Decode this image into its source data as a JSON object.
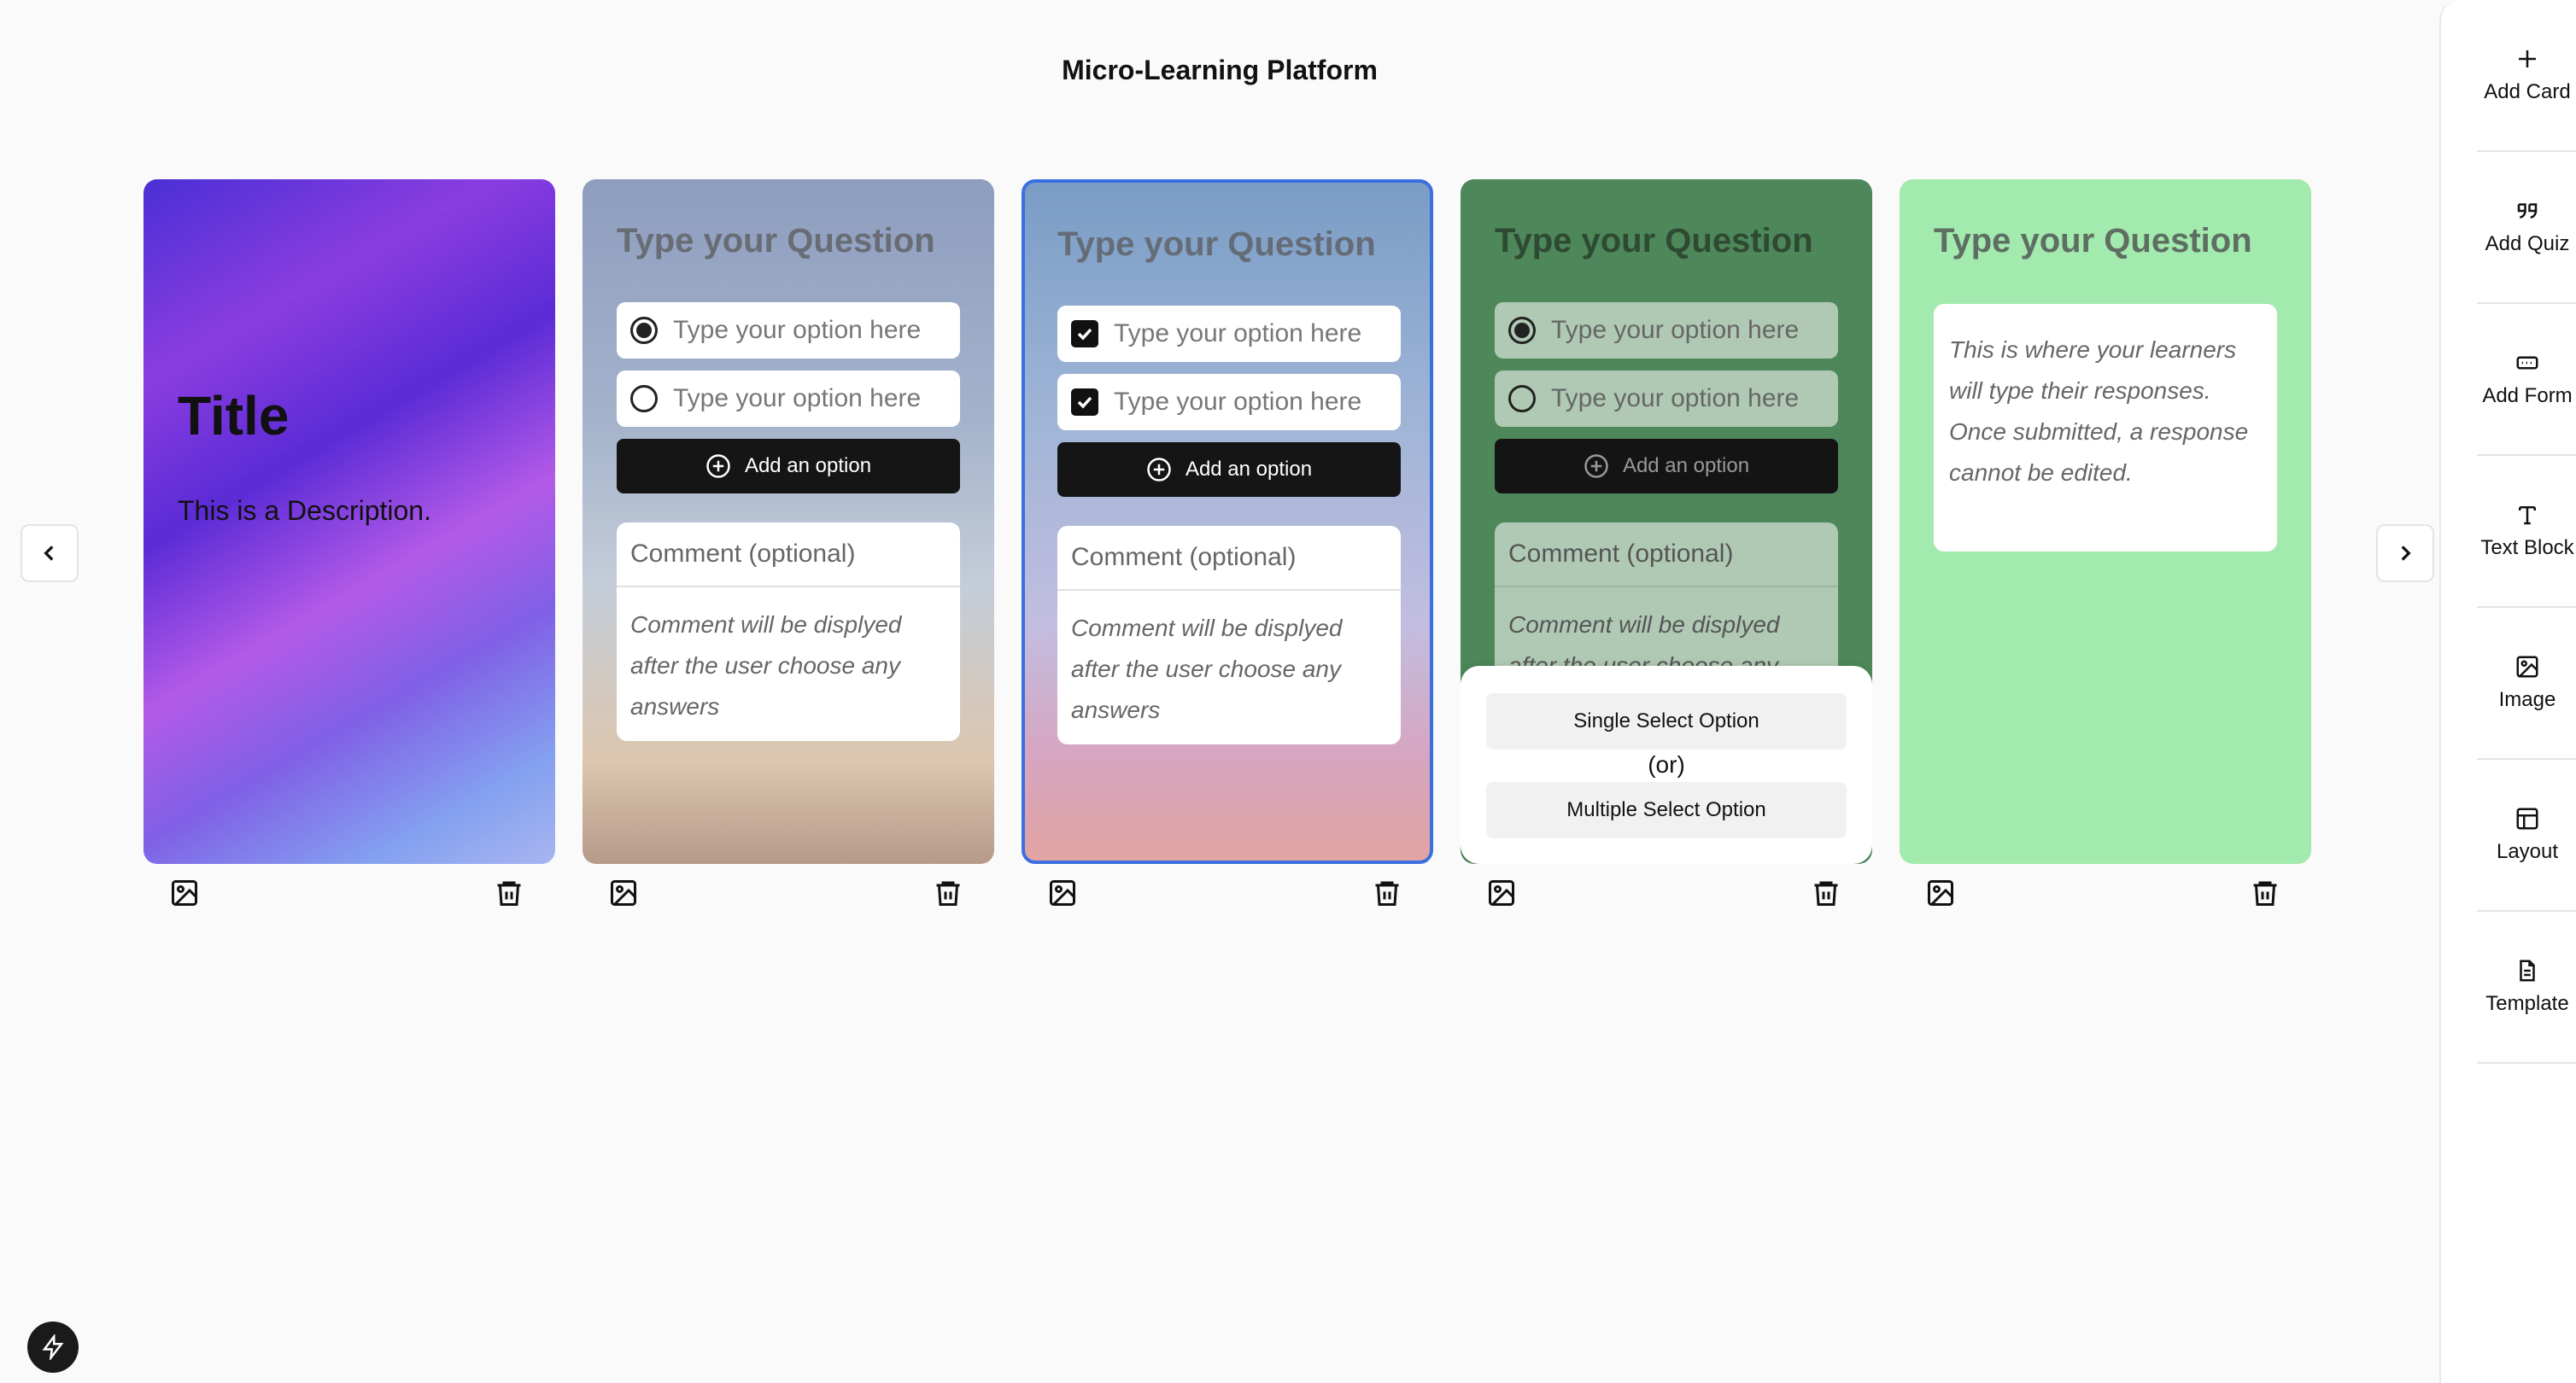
{
  "page_title": "Micro-Learning Platform",
  "toolbar": [
    {
      "label": "Add Card",
      "icon": "plus-icon"
    },
    {
      "label": "Add Quiz",
      "icon": "quote-icon"
    },
    {
      "label": "Add Form",
      "icon": "form-icon"
    },
    {
      "label": "Text Block",
      "icon": "text-icon"
    },
    {
      "label": "Image",
      "icon": "image-icon"
    },
    {
      "label": "Layout",
      "icon": "layout-icon"
    },
    {
      "label": "Template",
      "icon": "document-icon"
    }
  ],
  "cards": {
    "title_card": {
      "title": "Title",
      "description": "This is a Description."
    },
    "single_quiz": {
      "question_placeholder": "Type your Question",
      "options": [
        "Type your option here",
        "Type your option here"
      ],
      "add_option": "Add an option",
      "comment_placeholder": "Comment (optional)",
      "comment_hint": "Comment will be displyed after the user choose any answers"
    },
    "multi_quiz": {
      "question_placeholder": "Type your Question",
      "options": [
        "Type your option here",
        "Type your option here"
      ],
      "add_option": "Add an option",
      "comment_placeholder": "Comment (optional)",
      "comment_hint": "Comment will be displyed after the user choose any answers"
    },
    "selecting_quiz": {
      "question_placeholder": "Type your Question",
      "options": [
        "Type your option here",
        "Type your option here"
      ],
      "add_option": "Add an option",
      "comment_placeholder": "Comment (optional)",
      "comment_hint": "Comment will be displyed after the user choose any",
      "popup": {
        "single": "Single Select Option",
        "or": "(or)",
        "multiple": "Multiple Select Option"
      }
    },
    "form_card": {
      "question_placeholder": "Type your Question",
      "response_hint": "This is where your learners will type their responses. Once submitted, a response cannot be edited."
    }
  },
  "colors": {
    "selected_border": "#3b6fe0",
    "form_card_bg": "#a2eaae",
    "dark_card_bg": "#4e8759"
  }
}
